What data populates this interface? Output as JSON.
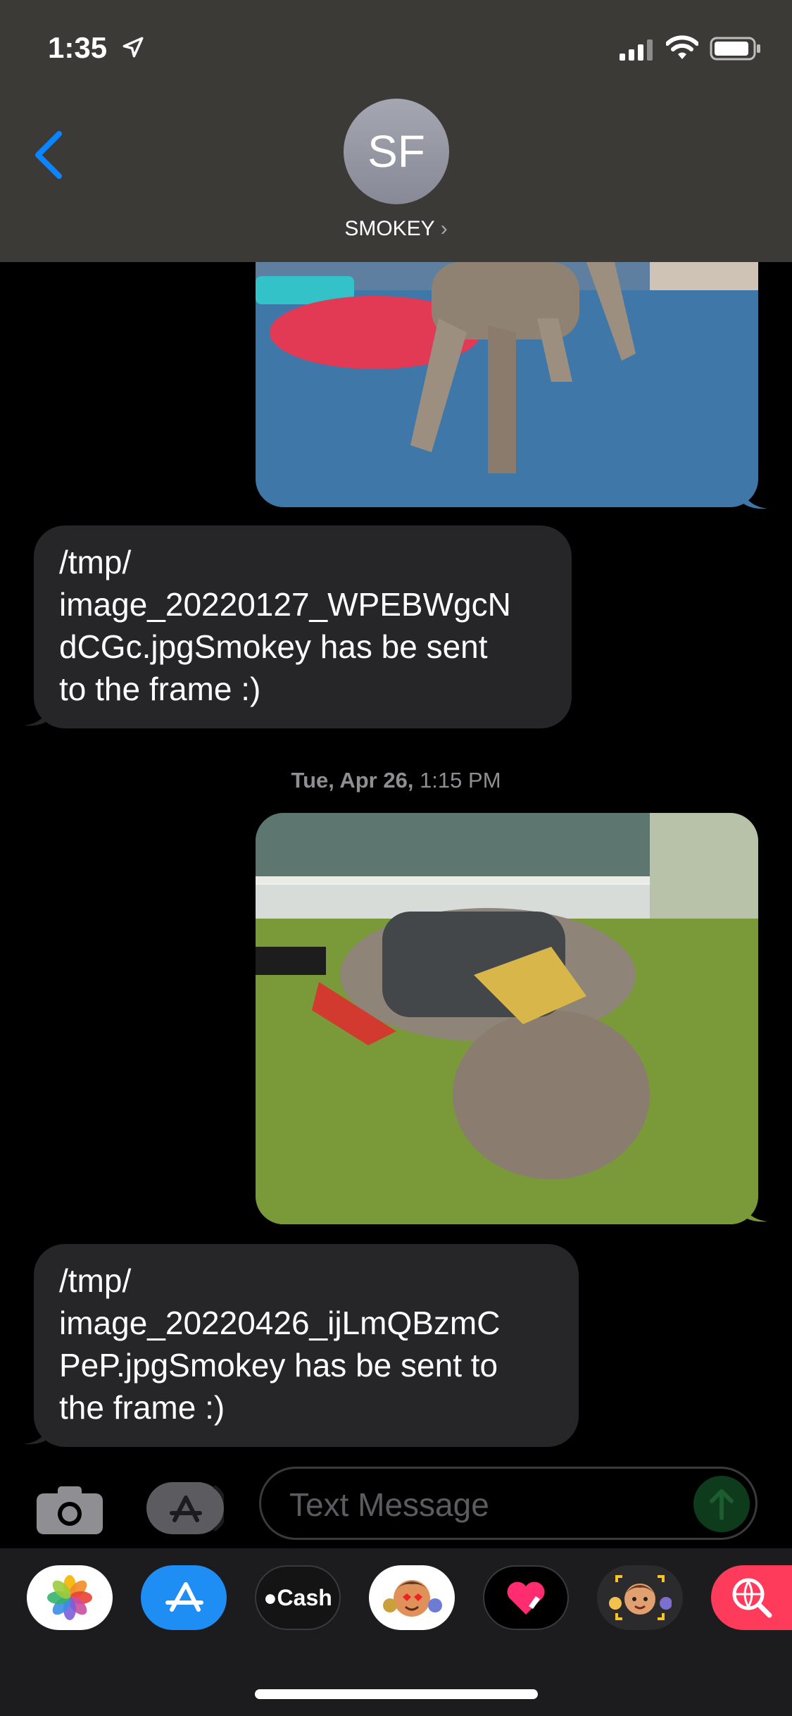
{
  "status_bar": {
    "time": "1:35"
  },
  "header": {
    "avatar_initials": "SF",
    "contact_name": "SMOKEY",
    "chevron": "›"
  },
  "messages": [
    {
      "type": "photo",
      "direction": "outgoing",
      "description_icon": "dog-photo"
    },
    {
      "type": "text",
      "direction": "incoming",
      "lines": [
        "/tmp/",
        "image_20220127_WPEBWgcN",
        "dCGc.jpgSmokey has be sent",
        "to the frame :)"
      ]
    },
    {
      "type": "photo",
      "direction": "outgoing",
      "description_icon": "dog-photo"
    },
    {
      "type": "text",
      "direction": "incoming",
      "lines": [
        "/tmp/",
        "image_20220426_ijLmQBzmC",
        "PeP.jpgSmokey has be sent to",
        "the frame :)"
      ]
    }
  ],
  "timestamp": {
    "day": "Tue, Apr 26,",
    "time": " 1:15 PM"
  },
  "input": {
    "placeholder": "Text Message"
  },
  "app_drawer": {
    "items": [
      {
        "name": "photos-app-icon"
      },
      {
        "name": "app-store-icon"
      },
      {
        "name": "apple-cash-icon",
        "label": "Cash"
      },
      {
        "name": "memoji-stickers-icon"
      },
      {
        "name": "digital-touch-icon"
      },
      {
        "name": "animoji-icon"
      },
      {
        "name": "web-search-icon"
      }
    ]
  },
  "colors": {
    "accent": "#0a84ff",
    "header_bg": "#3b3a36",
    "bubble_incoming": "#262628"
  }
}
